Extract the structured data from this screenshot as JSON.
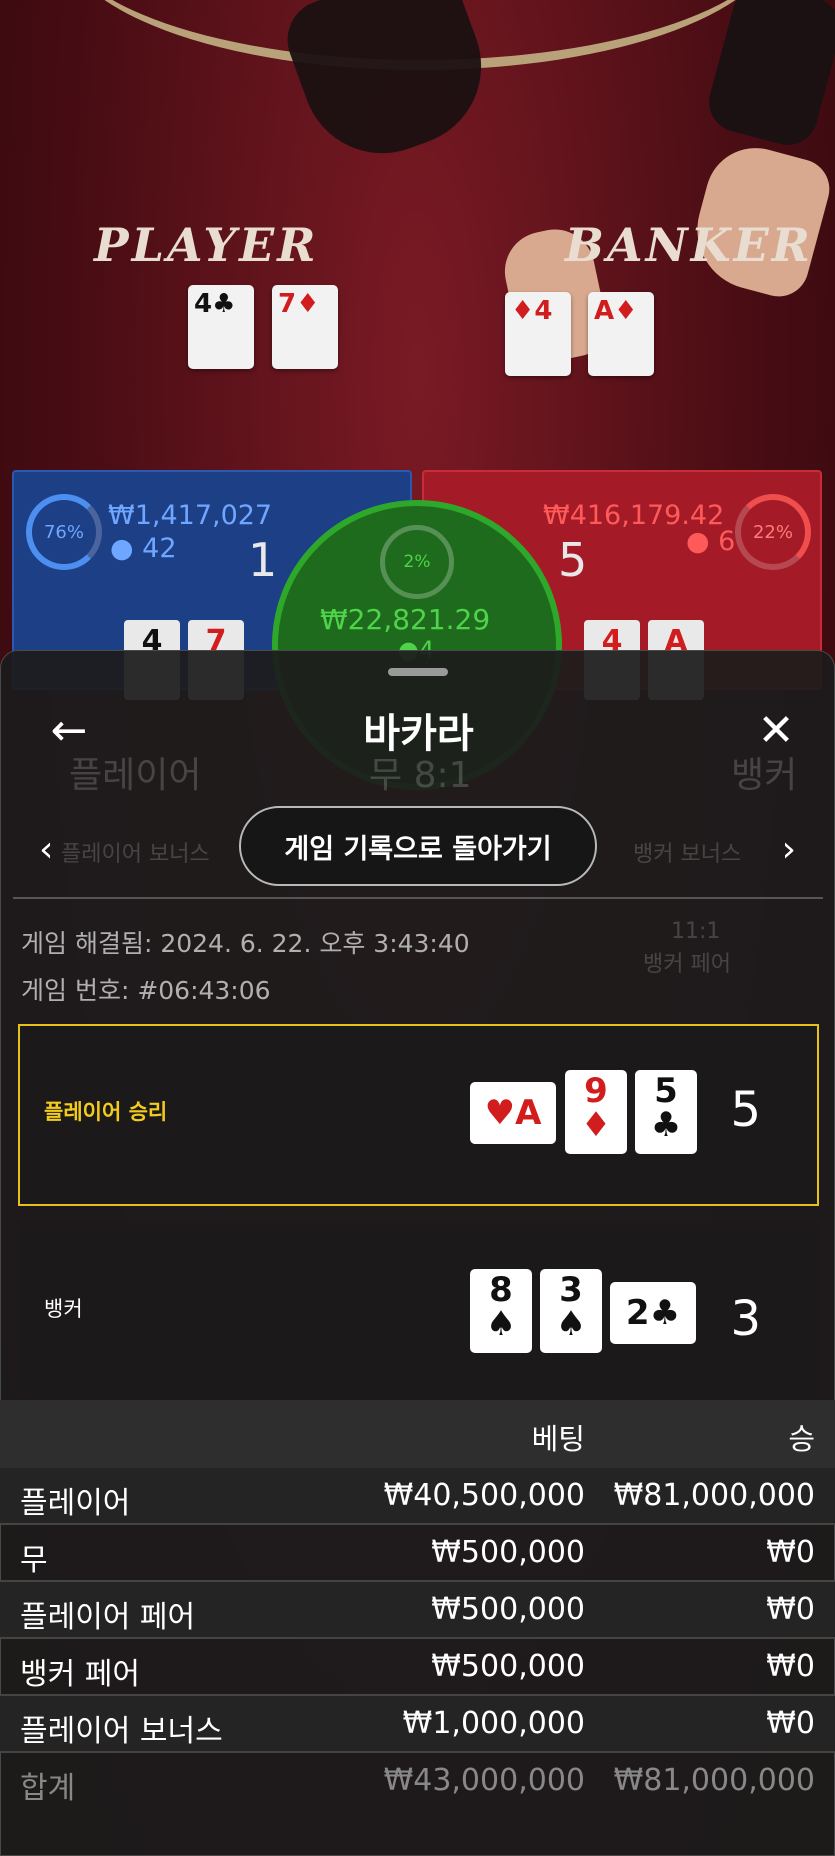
{
  "background": {
    "felt_player": "PLAYER",
    "felt_banker": "BANKER",
    "felt_player_cards": [
      {
        "rank": "4",
        "suit": "♣",
        "color": "black"
      },
      {
        "rank": "7",
        "suit": "♦",
        "color": "red"
      }
    ],
    "felt_banker_cards": [
      {
        "rank": "A",
        "suit": "♦",
        "color": "red"
      },
      {
        "rank": "4",
        "suit": "♦",
        "color": "red"
      }
    ],
    "player_panel": {
      "percent": "76%",
      "amount": "₩1,417,027",
      "players": "42",
      "score": "1",
      "cards": [
        "4",
        "7"
      ]
    },
    "banker_panel": {
      "percent": "22%",
      "amount": "₩416,179.42",
      "players": "6",
      "score": "5",
      "cards": [
        "4",
        "A"
      ]
    },
    "tie_panel": {
      "percent": "2%",
      "amount": "₩22,821.29",
      "players": "4"
    },
    "ghost": {
      "player": "플레이어",
      "tie": "무 8:1",
      "banker": "뱅커",
      "player_bonus": "플레이어 보너스",
      "banker_bonus": "뱅커 보너스",
      "banker_pair_odds": "11:1",
      "banker_pair": "뱅커 페어"
    }
  },
  "sheet": {
    "title": "바카라",
    "back_icon": "←",
    "close_icon": "✕",
    "prev_icon": "‹",
    "next_icon": "›",
    "return_button": "게임 기록으로 돌아가기",
    "resolved": "게임 해결됨: 2024. 6. 22. 오후 3:43:40",
    "game_number": "게임 번호: #06:43:06",
    "player_result": {
      "label": "플레이어 승리",
      "score": "5",
      "cards": [
        {
          "rank": "A",
          "suit": "♥",
          "color": "red",
          "rotated": true
        },
        {
          "rank": "9",
          "suit": "♦",
          "color": "red",
          "rotated": false
        },
        {
          "rank": "5",
          "suit": "♣",
          "color": "black",
          "rotated": false
        }
      ]
    },
    "banker_result": {
      "label": "뱅커",
      "score": "3",
      "cards": [
        {
          "rank": "8",
          "suit": "♠",
          "color": "black",
          "rotated": false
        },
        {
          "rank": "3",
          "suit": "♠",
          "color": "black",
          "rotated": false
        },
        {
          "rank": "2",
          "suit": "♣",
          "color": "black",
          "rotated": true
        }
      ]
    },
    "bet_table": {
      "headers": [
        "",
        "베팅",
        "승"
      ],
      "rows": [
        [
          "플레이어",
          "₩40,500,000",
          "₩81,000,000"
        ],
        [
          "무",
          "₩500,000",
          "₩0"
        ],
        [
          "플레이어 페어",
          "₩500,000",
          "₩0"
        ],
        [
          "뱅커 페어",
          "₩500,000",
          "₩0"
        ],
        [
          "플레이어 보너스",
          "₩1,000,000",
          "₩0"
        ],
        [
          "합계",
          "₩43,000,000",
          "₩81,000,000"
        ]
      ]
    }
  }
}
